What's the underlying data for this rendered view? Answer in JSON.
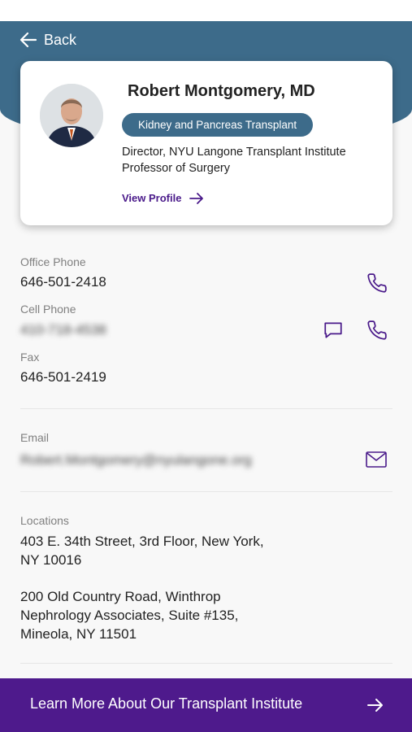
{
  "header": {
    "back_label": "Back"
  },
  "doctor": {
    "name": "Robert Montgomery, MD",
    "specialty": "Kidney and Pancreas Transplant",
    "titles": [
      "Director, NYU Langone Transplant Institute",
      "Professor of Surgery"
    ],
    "view_profile_label": "View Profile"
  },
  "contact": {
    "office_phone_label": "Office Phone",
    "office_phone": "646-501-2418",
    "cell_phone_label": "Cell Phone",
    "cell_phone": "410-718-4538",
    "fax_label": "Fax",
    "fax": "646-501-2419",
    "email_label": "Email",
    "email": "Robert.Montgomery@nyulangone.org"
  },
  "locations": {
    "label": "Locations",
    "list": [
      [
        "403 E. 34th Street, 3rd Floor, New York,",
        "NY 10016"
      ],
      [
        "200 Old Country Road, Winthrop",
        "Nephrology Associates, Suite #135,",
        "Mineola, NY 11501"
      ]
    ]
  },
  "footer": {
    "learn_more_label": "Learn More About Our Transplant Institute"
  },
  "colors": {
    "header": "#3d6b8a",
    "accent": "#4e1a8c",
    "icon": "#4a1a8a"
  },
  "icons": [
    "back-arrow-icon",
    "arrow-right-icon",
    "phone-icon",
    "chat-icon",
    "mail-icon"
  ]
}
